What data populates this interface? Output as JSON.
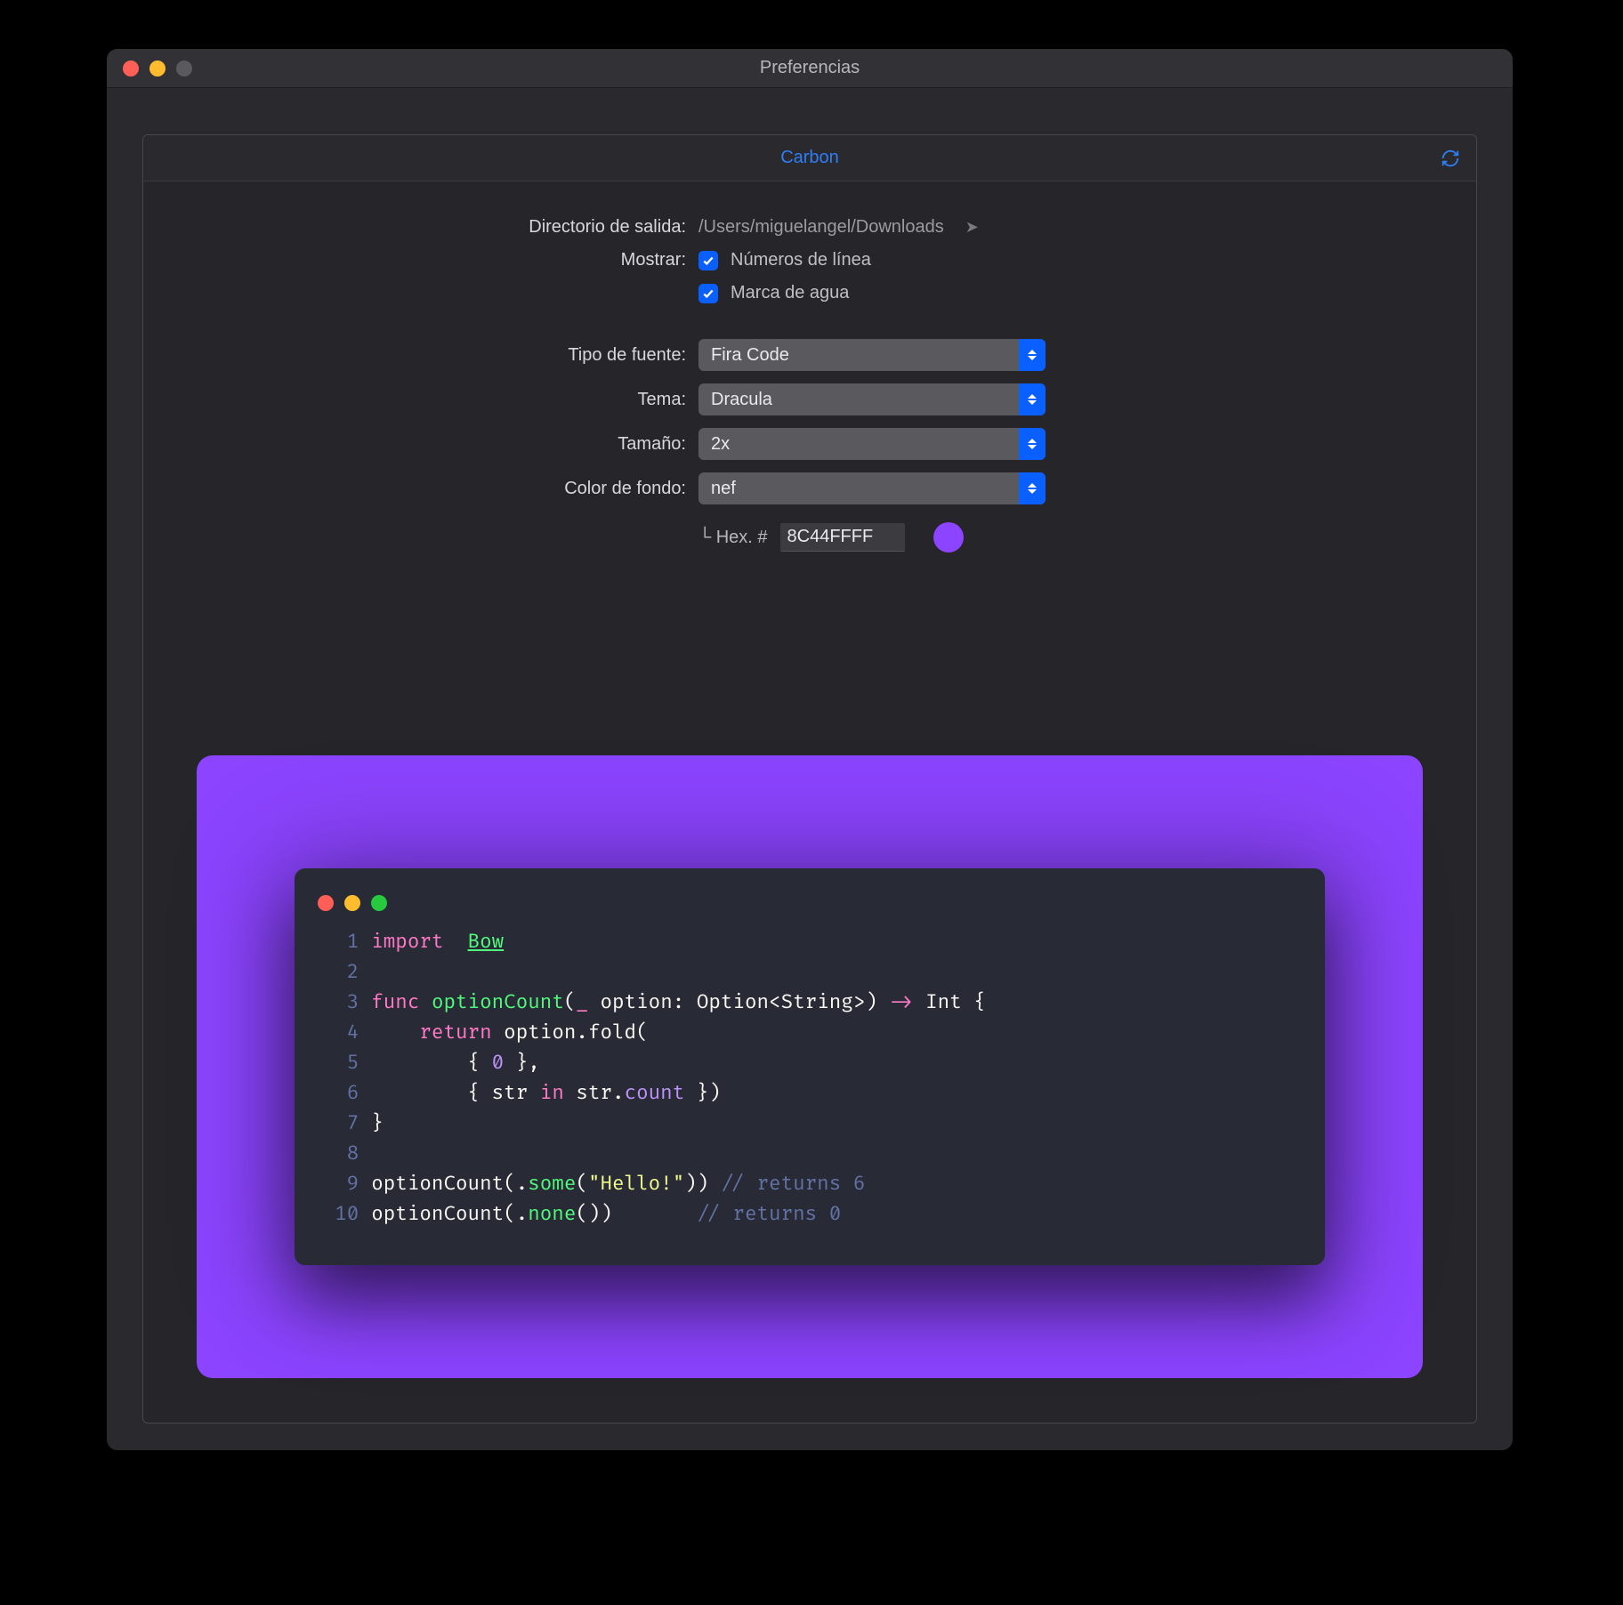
{
  "window": {
    "title": "Preferencias"
  },
  "tab": {
    "label": "Carbon"
  },
  "form": {
    "output_dir_label": "Directorio de salida:",
    "output_dir_value": "/Users/miguelangel/Downloads",
    "show_label": "Mostrar:",
    "show_line_numbers_label": "Números de línea",
    "show_watermark_label": "Marca de agua",
    "font_label": "Tipo de fuente:",
    "font_value": "Fira Code",
    "theme_label": "Tema:",
    "theme_value": "Dracula",
    "size_label": "Tamaño:",
    "size_value": "2x",
    "bg_label": "Color de fondo:",
    "bg_value": "nef",
    "hex_prefix": "└ Hex.  #",
    "hex_value": "8C44FFFF",
    "swatch_color": "#8C44FF"
  },
  "preview": {
    "bg_color": "#8C44FF",
    "lines": [
      {
        "n": "1",
        "html": "<span class='kw'>import</span>  <span class='fn under'>Bow</span>"
      },
      {
        "n": "2",
        "html": ""
      },
      {
        "n": "3",
        "html": "<span class='kw'>func</span> <span class='fn'>optionCount</span><span class='pl'>(</span><span class='kw'>_</span> <span class='pl'>option: Option&lt;String&gt;)</span> <span class='op'>-&gt;</span> <span class='pl'>Int {</span>"
      },
      {
        "n": "4",
        "html": "    <span class='kw'>return</span> <span class='pl'>option.fold(</span>"
      },
      {
        "n": "5",
        "html": "        <span class='pl'>{ </span><span class='num'>0</span><span class='pl'> },</span>"
      },
      {
        "n": "6",
        "html": "        <span class='pl'>{ str </span><span class='kw'>in</span><span class='pl'> str.</span><span class='prop'>count</span><span class='pl'> })</span>"
      },
      {
        "n": "7",
        "html": "<span class='pl'>}</span>"
      },
      {
        "n": "8",
        "html": ""
      },
      {
        "n": "9",
        "html": "<span class='pl'>optionCount(.</span><span class='fn'>some</span><span class='pl'>(</span><span class='str'>\"Hello!\"</span><span class='pl'>))</span> <span class='cm'>// returns 6</span>"
      },
      {
        "n": "10",
        "html": "<span class='pl'>optionCount(.</span><span class='fn'>none</span><span class='pl'>())</span>       <span class='cm'>// returns 0</span>"
      }
    ]
  }
}
